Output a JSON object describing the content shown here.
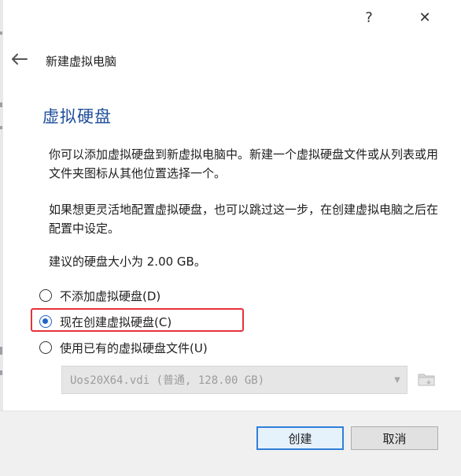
{
  "titlebar": {
    "help_glyph": "?",
    "close_glyph": "✕"
  },
  "wizard": {
    "title": "新建虚拟电脑"
  },
  "page": {
    "title": "虚拟硬盘",
    "para1": "你可以添加虚拟硬盘到新虚拟电脑中。新建一个虚拟硬盘文件或从列表或用文件夹图标从其他位置选择一个。",
    "para2": "如果想更灵活地配置虚拟硬盘，也可以跳过这一步，在创建虚拟电脑之后在配置中设定。",
    "para3": "建议的硬盘大小为 2.00 GB。"
  },
  "options": [
    {
      "label": "不添加虚拟硬盘(D)",
      "checked": false
    },
    {
      "label": "现在创建虚拟硬盘(C)",
      "checked": true
    },
    {
      "label": "使用已有的虚拟硬盘文件(U)",
      "checked": false
    }
  ],
  "disk_select": {
    "value": "Uos20X64.vdi (普通, 128.00 GB)",
    "enabled": false
  },
  "buttons": {
    "create": "创建",
    "cancel": "取消"
  },
  "colors": {
    "accent": "#1f63c9",
    "page_title": "#1f4e9a",
    "highlight": "#e5323a"
  }
}
